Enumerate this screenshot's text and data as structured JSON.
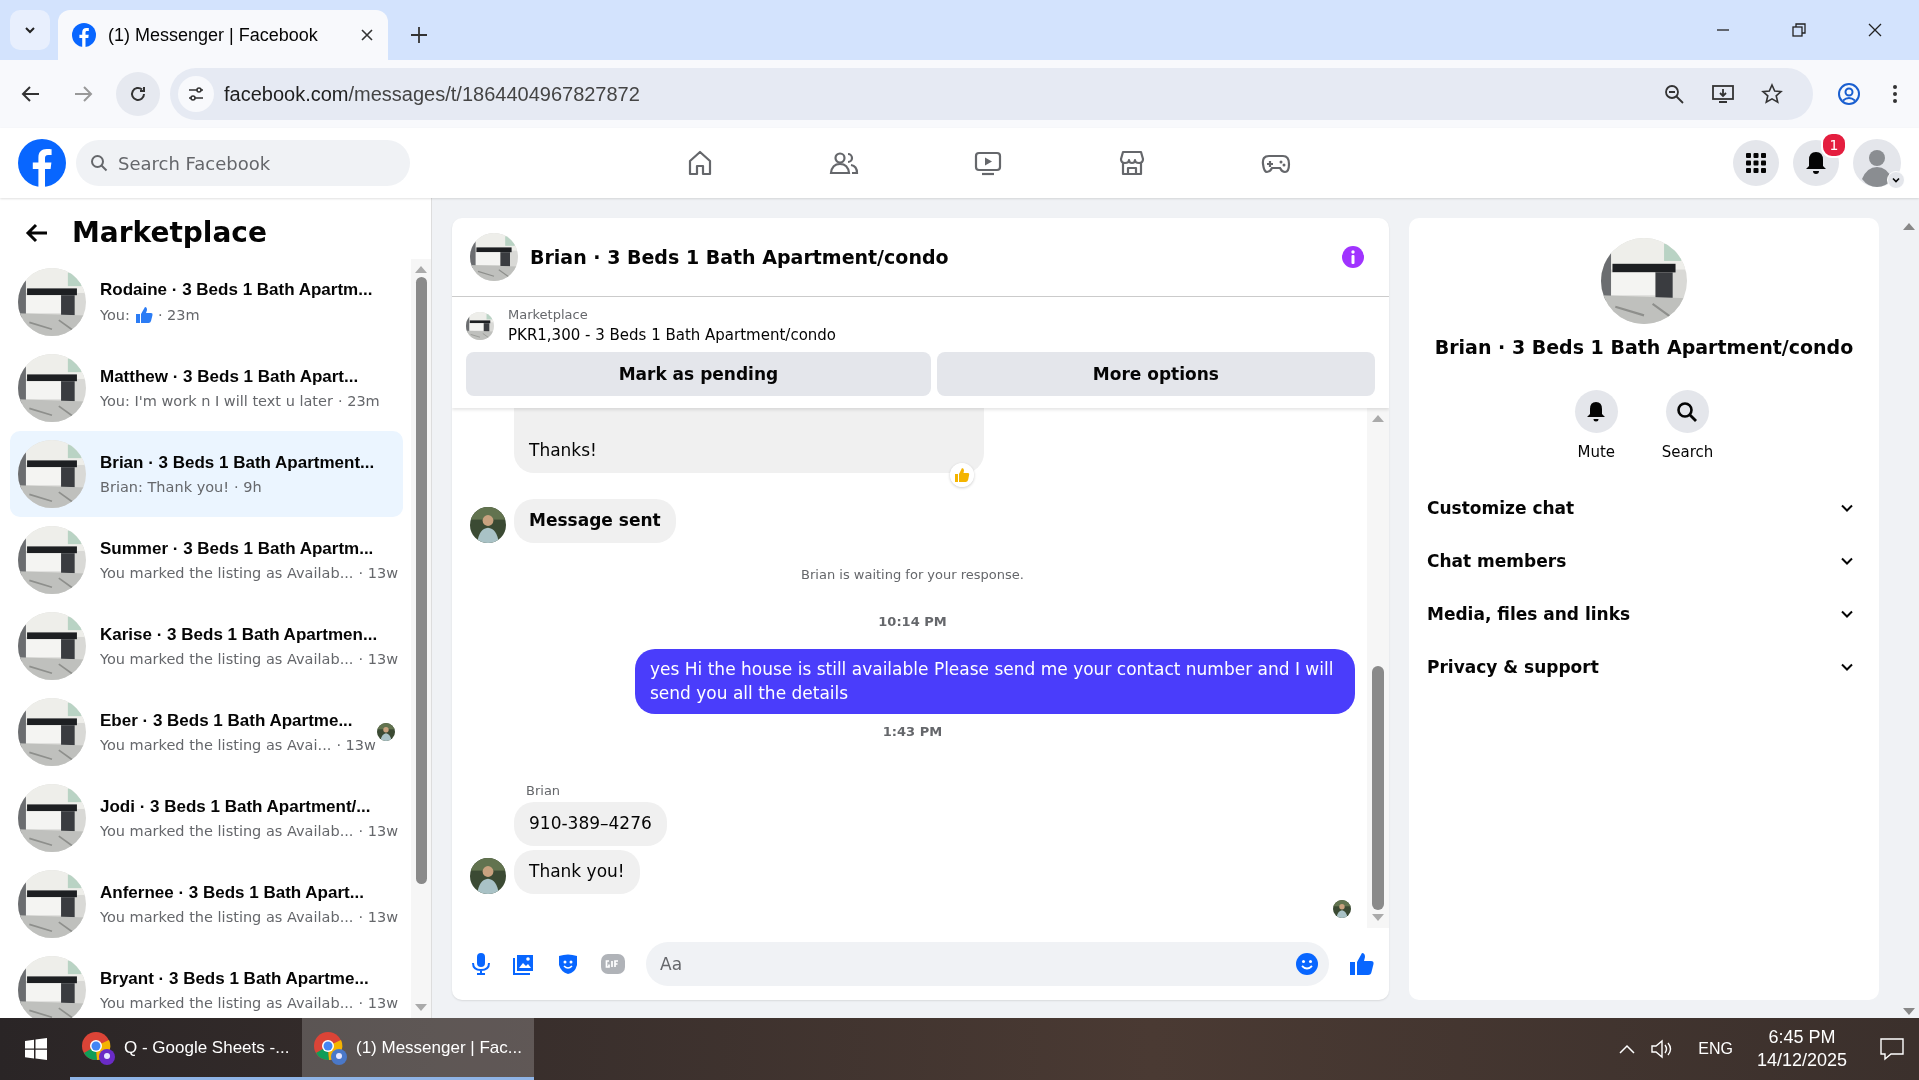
{
  "browser": {
    "tabs": [
      {
        "title": "(1) Messenger | Facebook",
        "selected": true
      }
    ],
    "address_domain": "facebook.com",
    "address_path": "/messages/t/1864404967827872"
  },
  "header": {
    "search": {
      "placeholder": "Search Facebook"
    },
    "nav": [
      {
        "kind": "home"
      },
      {
        "kind": "friends"
      },
      {
        "kind": "video"
      },
      {
        "kind": "marketplace"
      },
      {
        "kind": "gaming"
      }
    ],
    "notification_count": "1"
  },
  "sidebar": {
    "title": "Marketplace",
    "conversations": [
      {
        "name": "Rodaine · 3 Beds 1 Bath Apartm...",
        "preview": "You:",
        "like": true,
        "time": "· 23m",
        "selected": false,
        "seen": false
      },
      {
        "name": "Matthew · 3 Beds 1 Bath Apart...",
        "preview": "You: I'm work n I will text u later",
        "like": false,
        "time": "· 23m",
        "selected": false,
        "seen": false
      },
      {
        "name": "Brian · 3 Beds 1 Bath Apartment...",
        "preview": "Brian: Thank you!",
        "like": false,
        "time": "· 9h",
        "selected": true,
        "seen": false
      },
      {
        "name": "Summer · 3 Beds 1 Bath Apartm...",
        "preview": "You marked the listing as Availab...",
        "like": false,
        "time": "· 13w",
        "selected": false,
        "seen": false
      },
      {
        "name": "Karise · 3 Beds 1 Bath Apartmen...",
        "preview": "You marked the listing as Availab...",
        "like": false,
        "time": "· 13w",
        "selected": false,
        "seen": false
      },
      {
        "name": "Eber · 3 Beds 1 Bath Apartme...",
        "preview": "You marked the listing as Avai...",
        "like": false,
        "time": "· 13w",
        "selected": false,
        "seen": true
      },
      {
        "name": "Jodi · 3 Beds 1 Bath Apartment/...",
        "preview": "You marked the listing as Availab...",
        "like": false,
        "time": "· 13w",
        "selected": false,
        "seen": false
      },
      {
        "name": "Anfernee · 3 Beds 1 Bath Apart...",
        "preview": "You marked the listing as Availab...",
        "like": false,
        "time": "· 13w",
        "selected": false,
        "seen": false
      },
      {
        "name": "Bryant · 3 Beds 1 Bath Apartme...",
        "preview": "You marked the listing as Availab...",
        "like": false,
        "time": "· 13w",
        "selected": false,
        "seen": false
      }
    ]
  },
  "chat": {
    "title": "Brian · 3 Beds 1 Bath Apartment/condo",
    "listing": {
      "label": "Marketplace",
      "title": "PKR1,300 - 3 Beds 1 Bath Apartment/condo"
    },
    "buttons": [
      "Mark as pending",
      "More options"
    ],
    "messages": [
      {
        "kind": "incoming",
        "text": "Thanks!",
        "avatar": false,
        "reaction": true
      },
      {
        "kind": "incoming_bold",
        "text": "Message sent",
        "avatar": true,
        "reaction": false
      },
      {
        "kind": "notice",
        "text": "Brian is waiting for your response."
      },
      {
        "kind": "time",
        "text": "10:14 PM"
      },
      {
        "kind": "outgoing",
        "text": "yes Hi the house is still available Please send me your contact number and I will send you all the details"
      },
      {
        "kind": "time",
        "text": "1:43 PM"
      },
      {
        "kind": "sender",
        "text": "Brian"
      },
      {
        "kind": "incoming",
        "text": "910-389–4276",
        "avatar": false,
        "reaction": false
      },
      {
        "kind": "incoming",
        "text": "Thank you!",
        "avatar": true,
        "reaction": false
      }
    ],
    "composer": {
      "placeholder": "Aa"
    }
  },
  "info": {
    "title": "Brian · 3 Beds 1 Bath Apartment/condo",
    "actions": [
      {
        "kind": "mute",
        "label": "Mute"
      },
      {
        "kind": "search",
        "label": "Search"
      }
    ],
    "sections": [
      "Customize chat",
      "Chat members",
      "Media, files and links",
      "Privacy & support"
    ]
  },
  "taskbar": {
    "apps": [
      {
        "label": "Q - Google Sheets -...",
        "selected": false
      },
      {
        "label": "(1) Messenger | Fac...",
        "selected": true
      }
    ],
    "language": "ENG",
    "time": "6:45 PM",
    "date": "14/12/2025"
  }
}
